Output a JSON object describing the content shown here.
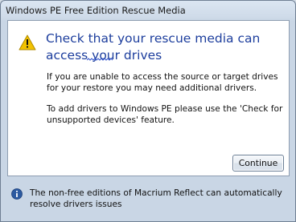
{
  "window": {
    "title": "Windows PE Free Edition Rescue Media"
  },
  "dialog": {
    "icon": "warning-icon",
    "heading": "Check that your rescue media can access your drives",
    "paragraph_1": "If you are unable to access the source or target drives for your restore you may need additional drivers.",
    "paragraph_2": "To add drivers to Windows PE please use the 'Check for unsupported devices' feature.",
    "continue_label": "Continue"
  },
  "footer": {
    "icon": "info-icon",
    "text": "The non-free editions of Macrium Reflect can automatically resolve drivers issues"
  },
  "colors": {
    "heading": "#1d3e9d",
    "warning_icon": "#f2c200",
    "info_icon": "#2c5aa0",
    "frame": "#c9d6e5"
  }
}
